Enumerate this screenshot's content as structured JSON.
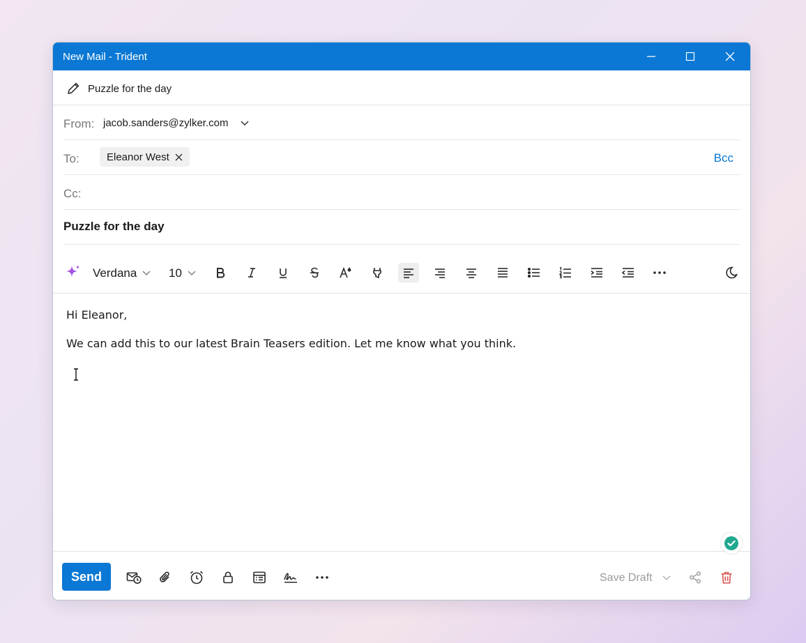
{
  "window": {
    "title": "New Mail - Trident",
    "accent_color": "#0a78d4"
  },
  "header": {
    "subject_display": "Puzzle for the day"
  },
  "from": {
    "label": "From:",
    "value": "jacob.sanders@zylker.com"
  },
  "to": {
    "label": "To:",
    "recipients": [
      {
        "name": "Eleanor West"
      }
    ],
    "bcc_label": "Bcc"
  },
  "cc": {
    "label": "Cc:"
  },
  "subject": {
    "value": "Puzzle for the day"
  },
  "toolbar": {
    "font": "Verdana",
    "size": "10",
    "icons": [
      "ai-sparkle-icon",
      "bold-icon",
      "italic-icon",
      "underline-icon",
      "strikethrough-icon",
      "font-color-icon",
      "highlighter-icon",
      "align-left-icon",
      "align-right-icon",
      "align-center-icon",
      "align-justify-icon",
      "bullet-list-icon",
      "numbered-list-icon",
      "indent-icon",
      "outdent-icon",
      "more-icon",
      "dark-mode-icon"
    ],
    "active": "align-left"
  },
  "body": {
    "lines": [
      "Hi Eleanor,",
      "We can add this to our latest Brain Teasers edition. Let me know what you think."
    ]
  },
  "footer": {
    "send_label": "Send",
    "save_draft_label": "Save Draft",
    "delete_color": "#d9534f"
  }
}
